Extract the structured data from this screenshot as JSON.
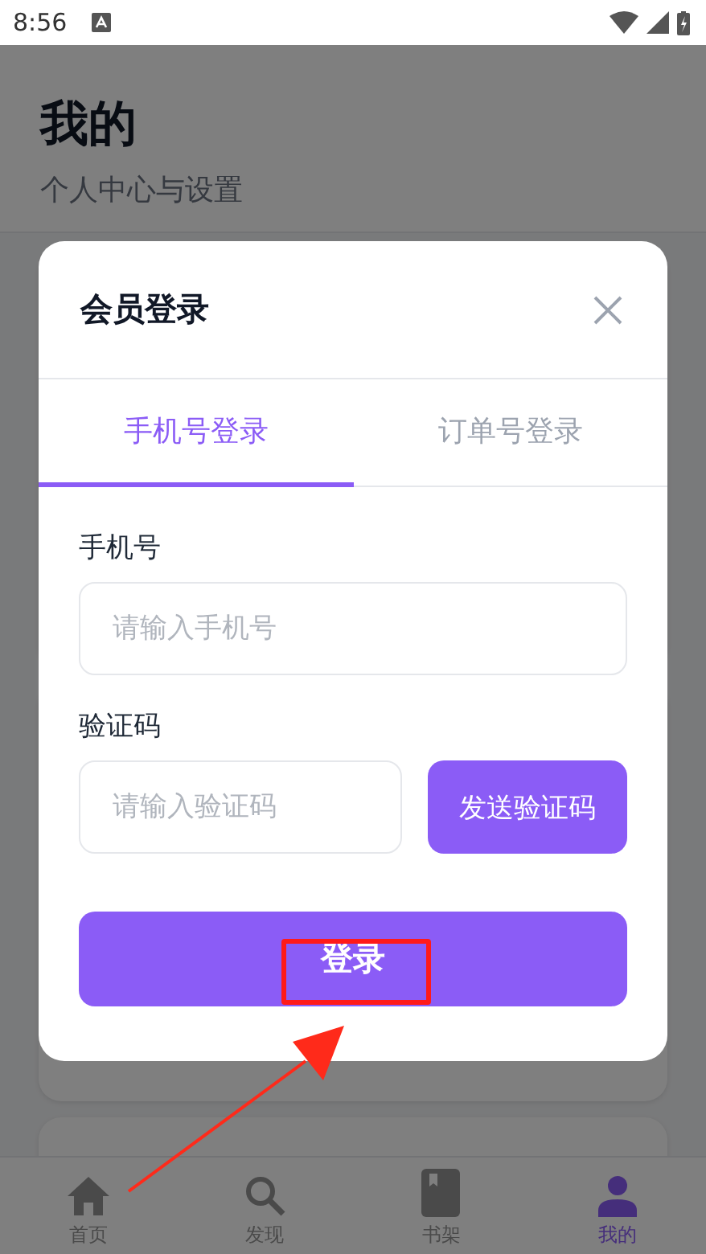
{
  "status_bar": {
    "time": "8:56"
  },
  "page": {
    "title": "我的",
    "subtitle": "个人中心与设置"
  },
  "dialog": {
    "title": "会员登录",
    "tabs": [
      {
        "label": "手机号登录",
        "selected": true
      },
      {
        "label": "订单号登录",
        "selected": false
      }
    ],
    "fields": [
      {
        "label": "手机号",
        "placeholder": "请输入手机号"
      },
      {
        "label": "验证码",
        "placeholder": "请输入验证码",
        "button": "发送验证码"
      }
    ],
    "submit": "登录"
  },
  "bottom_nav": [
    {
      "kind": "home",
      "label": "首页",
      "selected": false
    },
    {
      "kind": "search",
      "label": "发现",
      "selected": false
    },
    {
      "kind": "book",
      "label": "书架",
      "selected": false
    },
    {
      "kind": "person",
      "label": "我的",
      "selected": true
    }
  ]
}
